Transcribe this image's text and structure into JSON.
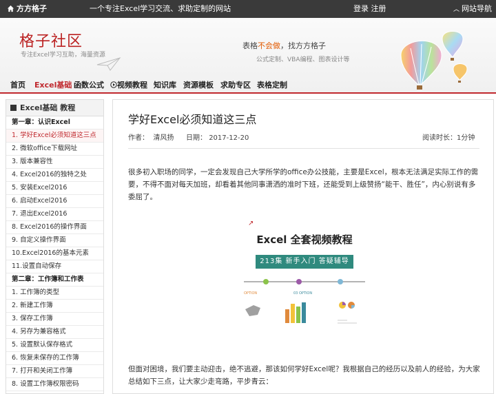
{
  "topbar": {
    "site_name": "方方格子",
    "slogan": "一个专注Excel学习交流、求助定制的网站",
    "login": "登录",
    "register": "注册",
    "site_nav": "网站导航"
  },
  "header": {
    "brand": "格子社区",
    "brand_sub": "专注Excel学习互助，海量资源",
    "tagline_pre": "表格",
    "tagline_hl": "不会做",
    "tagline_post": "，找方方格子",
    "tagline2": "公式定制、VBA编程、图表设计等"
  },
  "nav": {
    "items": [
      "首页",
      "Excel基础",
      "函数公式",
      "视频教程",
      "知识库",
      "资源模板",
      "求助专区",
      "表格定制"
    ],
    "active_index": 1
  },
  "sidebar": {
    "title": "Excel基础 教程",
    "items": [
      {
        "label": "第一章：认识Excel",
        "type": "chapter"
      },
      {
        "label": "1. 学好Excel必须知道这三点",
        "type": "current"
      },
      {
        "label": "2. 微软office下载网址",
        "type": "item"
      },
      {
        "label": "3. 版本兼容性",
        "type": "item"
      },
      {
        "label": "4. Excel2016的独特之处",
        "type": "item"
      },
      {
        "label": "5. 安装Excel2016",
        "type": "item"
      },
      {
        "label": "6. 启动Excel2016",
        "type": "item"
      },
      {
        "label": "7. 退出Excel2016",
        "type": "item"
      },
      {
        "label": "8. Excel2016的操作界面",
        "type": "item"
      },
      {
        "label": "9. 自定义操作界面",
        "type": "item"
      },
      {
        "label": "10.Excel2016的基本元素",
        "type": "item"
      },
      {
        "label": "11.设置自动保存",
        "type": "item"
      },
      {
        "label": "第二章：工作簿和工作表",
        "type": "chapter"
      },
      {
        "label": "1. 工作簿的类型",
        "type": "item"
      },
      {
        "label": "2. 新建工作簿",
        "type": "item"
      },
      {
        "label": "3. 保存工作簿",
        "type": "item"
      },
      {
        "label": "4. 另存为兼容格式",
        "type": "item"
      },
      {
        "label": "5. 设置默认保存格式",
        "type": "item"
      },
      {
        "label": "6. 恢复未保存的工作簿",
        "type": "item"
      },
      {
        "label": "7. 打开和关闭工作簿",
        "type": "item"
      },
      {
        "label": "8. 设置工作簿权限密码",
        "type": "item"
      }
    ]
  },
  "article": {
    "title": "学好Excel必须知道这三点",
    "author_label": "作者：",
    "author": "清风扬",
    "date_label": "日期：",
    "date": "2017-12-20",
    "read_label": "阅读时长：",
    "read_time": "1分钟",
    "para1": "很多初入职场的同学，一定会发现自己大学所学的office办公技能，主要是Excel，根本无法满足实际工作的需要，不得不面对每天加班，却看着其他同事潇洒的准时下班，还能受到上级赞扬“能干、胜任”，内心别说有多委屈了。",
    "para2": "但面对困境，我们要主动迎击，绝不逃避，那该如何学好Excel呢？我根据自己的经历以及前人的经验，为大家总结如下三点，让大家少走弯路，平步青云："
  },
  "promo": {
    "title": "Excel 全套视频教程",
    "band": "213集  新手入门  答疑辅导",
    "option_a": "OPTION",
    "option_b": "03 OPTION"
  },
  "colors": {
    "brand_red": "#c0282d",
    "topbar_bg": "#3a3a3a",
    "promo_band": "#2f8a7e"
  }
}
